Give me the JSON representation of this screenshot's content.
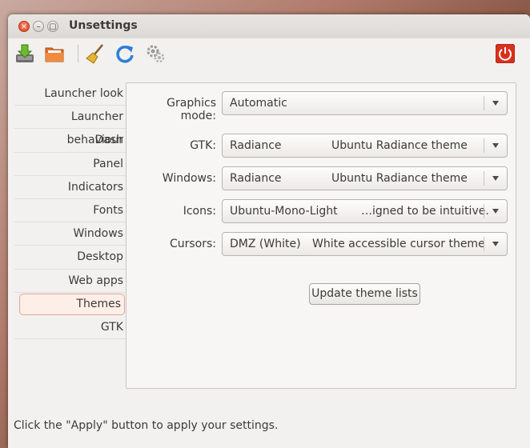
{
  "window": {
    "title": "Unsettings"
  },
  "toolbar": {
    "icons": [
      "save-icon",
      "folder-icon",
      "broom-icon",
      "refresh-icon",
      "gears-icon",
      "power-icon"
    ]
  },
  "sidebar": {
    "items": [
      {
        "label": "Launcher look"
      },
      {
        "label": "Launcher behaviour"
      },
      {
        "label": "Dash"
      },
      {
        "label": "Panel"
      },
      {
        "label": "Indicators"
      },
      {
        "label": "Fonts"
      },
      {
        "label": "Windows"
      },
      {
        "label": "Desktop"
      },
      {
        "label": "Web apps"
      },
      {
        "label": "Themes"
      },
      {
        "label": "GTK"
      }
    ],
    "active": "Themes"
  },
  "themes": {
    "graphics_mode": {
      "label": "Graphics mode:",
      "value": "Automatic"
    },
    "gtk": {
      "label": "GTK:",
      "name": "Radiance",
      "description": "Ubuntu Radiance theme"
    },
    "windows": {
      "label": "Windows:",
      "name": "Radiance",
      "description": "Ubuntu Radiance theme"
    },
    "icons": {
      "label": "Icons:",
      "name": "Ubuntu-Mono-Light",
      "description": "…igned to be intuitive."
    },
    "cursors": {
      "label": "Cursors:",
      "name": "DMZ (White)",
      "description": "White accessible cursor theme"
    },
    "update_button": "Update theme lists"
  },
  "status_bar": {
    "text": "Click the \"Apply\" button to apply your settings."
  },
  "colors": {
    "accent": "#e0441e",
    "active_bg": "#fdeee8"
  }
}
